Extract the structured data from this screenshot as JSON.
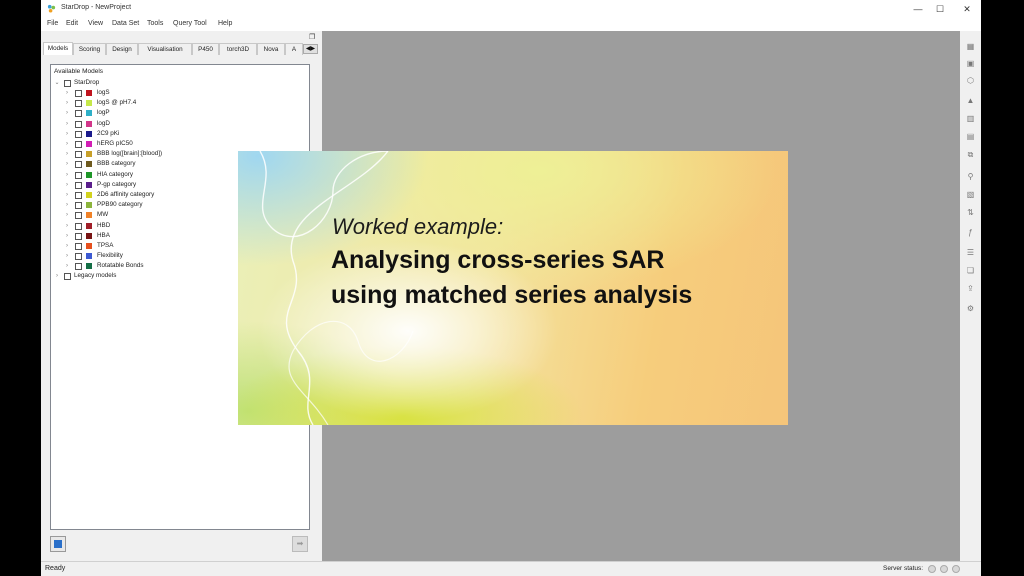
{
  "window": {
    "title": "StarDrop - NewProject",
    "controls": {
      "minimize": "—",
      "maximize": "☐",
      "close": "✕"
    }
  },
  "menubar": [
    "File",
    "Edit",
    "View",
    "Data Set",
    "Tools",
    "Query Tool",
    "Help"
  ],
  "left_panel": {
    "tabs": [
      "Models",
      "Scoring",
      "Design",
      "Visualisation",
      "P450",
      "torch3D",
      "Nova",
      "A"
    ],
    "active_tab": "Models",
    "tree": {
      "header": "Available Models",
      "root_label": "StarDrop",
      "items": [
        {
          "label": "logS",
          "color": "#c0141e"
        },
        {
          "label": "logS @ pH7.4",
          "color": "#c6e84a"
        },
        {
          "label": "logP",
          "color": "#2fb0c8"
        },
        {
          "label": "logD",
          "color": "#d2368a"
        },
        {
          "label": "2C9 pKi",
          "color": "#1a1a8c"
        },
        {
          "label": "hERG pIC50",
          "color": "#d21eb4"
        },
        {
          "label": "BBB log([brain]:[blood])",
          "color": "#c8a028"
        },
        {
          "label": "BBB category",
          "color": "#6e5a1e"
        },
        {
          "label": "HIA category",
          "color": "#1e9628"
        },
        {
          "label": "P-gp category",
          "color": "#5a1e8c"
        },
        {
          "label": "2D6 affinity category",
          "color": "#d2d21e"
        },
        {
          "label": "PPB90 category",
          "color": "#8cb43c"
        },
        {
          "label": "MW",
          "color": "#f08228"
        },
        {
          "label": "HBD",
          "color": "#a01e28"
        },
        {
          "label": "HBA",
          "color": "#781414"
        },
        {
          "label": "TPSA",
          "color": "#e6501e"
        },
        {
          "label": "Flexibility",
          "color": "#3c5ad2"
        },
        {
          "label": "Rotatable Bonds",
          "color": "#146e46"
        }
      ],
      "legacy_label": "Legacy models"
    }
  },
  "banner": {
    "kicker": "Worked example:",
    "line1": "Analysing cross-series SAR",
    "line2": "using matched series analysis"
  },
  "statusbar": {
    "left": "Ready",
    "right": "Server status:"
  }
}
